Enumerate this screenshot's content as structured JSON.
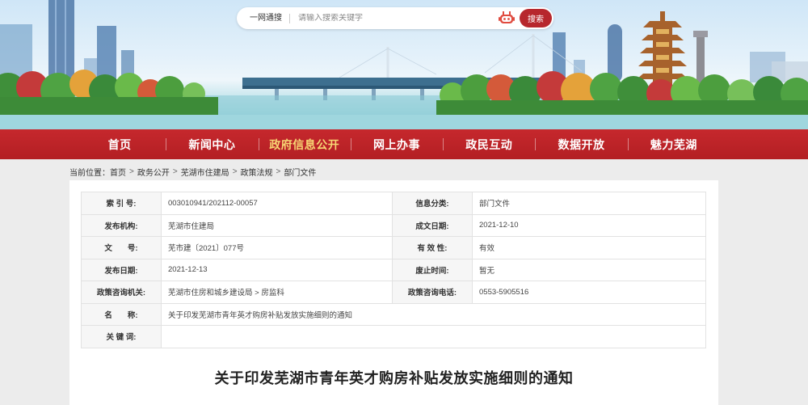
{
  "search": {
    "scope_label": "一网通搜",
    "placeholder": "请输入搜索关键字",
    "button_label": "搜索"
  },
  "nav": {
    "items": [
      {
        "label": "首页"
      },
      {
        "label": "新闻中心"
      },
      {
        "label": "政府信息公开",
        "active": true
      },
      {
        "label": "网上办事"
      },
      {
        "label": "政民互动"
      },
      {
        "label": "数据开放"
      },
      {
        "label": "魅力芜湖"
      }
    ]
  },
  "breadcrumb": {
    "lead": "当前位置：",
    "items": [
      "首页",
      "政务公开",
      "芜湖市住建局",
      "政策法规",
      "部门文件"
    ],
    "separator": ">"
  },
  "meta": {
    "rows": [
      {
        "k1": "索 引 号:",
        "v1": "003010941/202112-00057",
        "k2": "信息分类:",
        "v2": "部门文件"
      },
      {
        "k1": "发布机构:",
        "v1": "芜湖市住建局",
        "k2": "成文日期:",
        "v2": "2021-12-10"
      },
      {
        "k1": "文　　号:",
        "v1": "芜市建〔2021〕077号",
        "k2": "有 效 性:",
        "v2": "有效"
      },
      {
        "k1": "发布日期:",
        "v1": "2021-12-13",
        "k2": "废止时间:",
        "v2": "暂无"
      },
      {
        "k1": "政策咨询机关:",
        "v1": "芜湖市住房和城乡建设局 > 房监科",
        "k2": "政策咨询电话:",
        "v2": "0553-5905516"
      }
    ],
    "name_label": "名　　称:",
    "name_value": "关于印发芜湖市青年英才购房补贴发放实施细则的通知",
    "keywords_label": "关 键 词:",
    "keywords_value": ""
  },
  "document": {
    "title": "关于印发芜湖市青年英才购房补贴发放实施细则的通知"
  },
  "colors": {
    "brand_red": "#b7272d",
    "nav_active": "#f7d674",
    "panel_bg": "#ffffff",
    "page_bg": "#ececec"
  }
}
